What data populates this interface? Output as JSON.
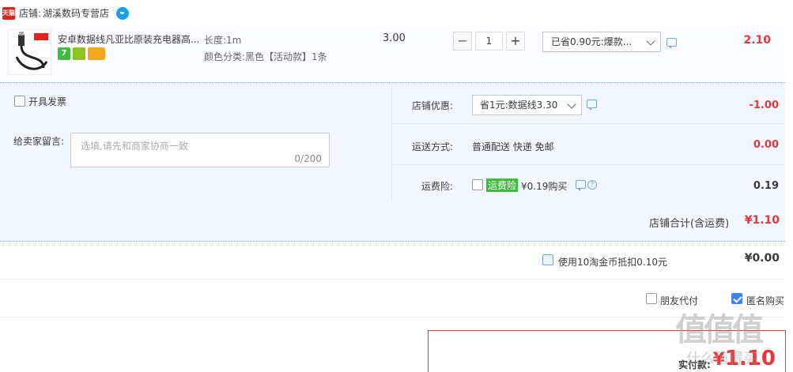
{
  "shop": {
    "badge": "天猫",
    "label": "店铺:",
    "name": "湖溪数码专营店"
  },
  "item": {
    "title": "安卓数据线凡亚比原装充电器高...",
    "badges": [
      "7",
      "",
      ""
    ],
    "sku_length": "长度:1m",
    "sku_color": "颜色分类:黑色【活动款】1条",
    "unit_price": "3.00",
    "qty": {
      "minus": "−",
      "value": "1",
      "plus": "+"
    },
    "promo": "已省0.90元:爆款...",
    "subtotal": "2.10"
  },
  "options": {
    "invoice_label": "开具发票",
    "memo_label": "给卖家留言:",
    "memo_placeholder": "选填,请先和商家协商一致",
    "memo_count": "0/200"
  },
  "summary": {
    "coupon_label": "店铺优惠:",
    "coupon_value": "省1元:数据线3.30",
    "coupon_amount": "-1.00",
    "shipping_label": "运送方式:",
    "shipping_value": "普通配送 快递 免邮",
    "shipping_amount": "0.00",
    "insurance_label": "运费险:",
    "insurance_tag": "运费险",
    "insurance_text": "¥0.19购买",
    "insurance_amount": "0.19",
    "help": "?"
  },
  "shop_total": {
    "label": "店铺合计(含运费)",
    "value": "¥1.10"
  },
  "coins": {
    "label": "使用10淘金币抵扣0.10元",
    "value": "¥0.00"
  },
  "pay_options": {
    "friend_label": "朋友代付",
    "anon_label": "匿名购买",
    "anon_checked": true
  },
  "final": {
    "label": "实付款:",
    "symbol": "¥",
    "value": "1.10"
  },
  "watermark": {
    "main": "值值值",
    "sub": "什么值得买"
  },
  "colors": {
    "price_red": "#e4393c",
    "accent_blue": "#3a85ff",
    "row_bg": "#f2f7ff"
  }
}
